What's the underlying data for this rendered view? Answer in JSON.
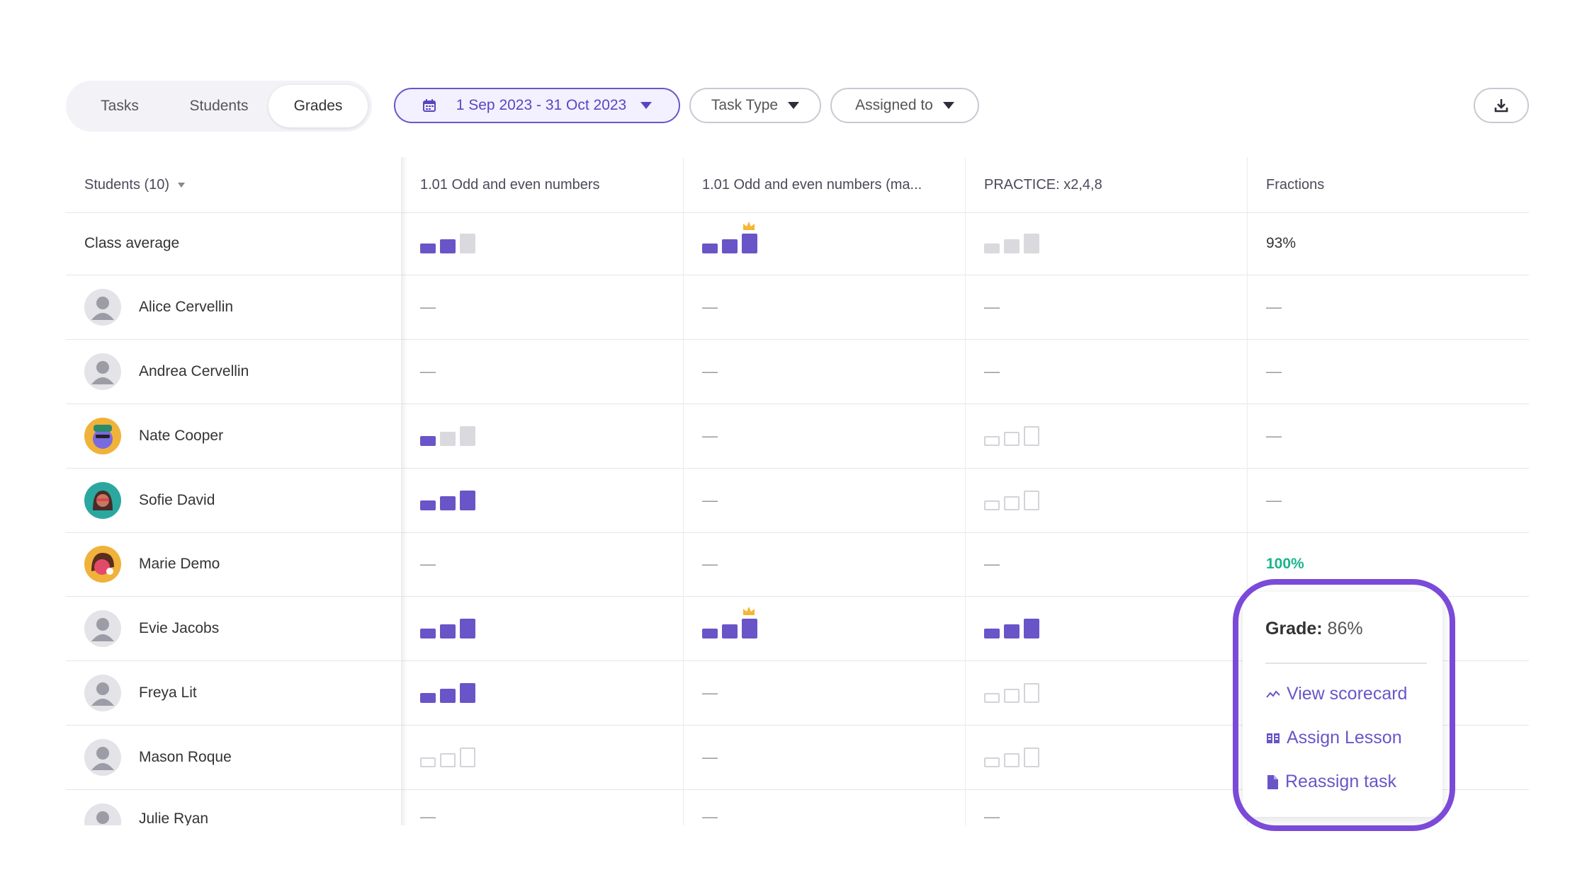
{
  "toolbar": {
    "tabs": [
      "Tasks",
      "Students",
      "Grades"
    ],
    "active_tab": "Grades",
    "date_range": "1 Sep 2023 - 31 Oct 2023",
    "task_type": "Task Type",
    "assigned_to": "Assigned to"
  },
  "table": {
    "columns": [
      "Students (10)",
      "1.01 Odd and even numbers",
      "1.01 Odd and even numbers (ma...",
      "PRACTICE: x2,4,8",
      "Fractions"
    ],
    "class_average_label": "Class average",
    "class_average_fractions": "93%",
    "dash": "—",
    "students": [
      {
        "name": "Alice Cervellin"
      },
      {
        "name": "Andrea Cervellin"
      },
      {
        "name": "Nate Cooper"
      },
      {
        "name": "Sofie David"
      },
      {
        "name": "Marie Demo",
        "fractions": "100%"
      },
      {
        "name": "Evie Jacobs"
      },
      {
        "name": "Freya Lit"
      },
      {
        "name": "Mason Roque"
      },
      {
        "name": "Julie Ryan"
      }
    ]
  },
  "popup": {
    "grade_label": "Grade:",
    "grade_value": "86%",
    "items": [
      "View scorecard",
      "Assign Lesson",
      "Reassign task"
    ]
  },
  "colors": {
    "accent": "#6a55c8",
    "highlight": "#7b4ad8",
    "success": "#19b48a",
    "crown": "#f5b731"
  }
}
